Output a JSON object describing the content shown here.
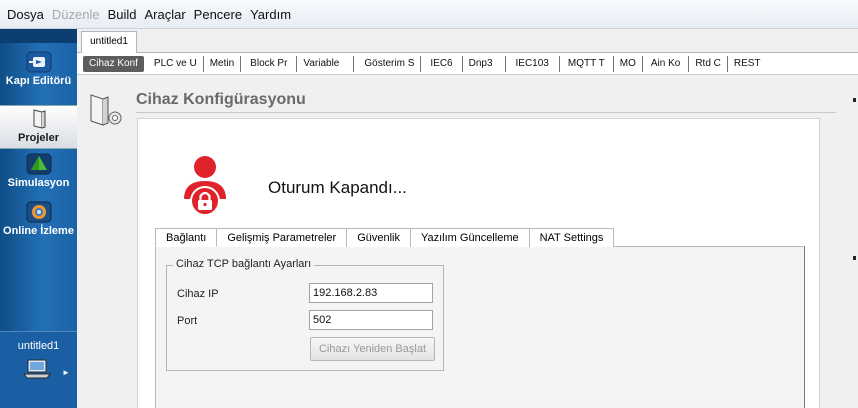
{
  "menu": [
    "Dosya",
    "Düzenle",
    "Build",
    "Araçlar",
    "Pencere",
    "Yardım"
  ],
  "sidebar": {
    "items": [
      {
        "label": "Kapı Editörü",
        "icon": "gateway-editor-icon"
      },
      {
        "label": "Projeler",
        "icon": "projects-icon"
      },
      {
        "label": "Simulasyon",
        "icon": "simulation-icon"
      },
      {
        "label": "Online İzleme",
        "icon": "online-monitor-icon"
      }
    ],
    "project_name": "untitled1",
    "project_icon": "laptop-icon"
  },
  "document_tab": "untitled1",
  "config_tabs": [
    "Cihaz Konf",
    "PLC ve U",
    "Metin",
    "Block Pr",
    "Variable",
    "Gösterim S",
    "IEC6",
    "Dnp3",
    "IEC103",
    "MQTT T",
    "MO",
    "Ain Ko",
    "Rtd C",
    "REST"
  ],
  "page": {
    "title": "Cihaz Konfigürasyonu",
    "status_text": "Oturum Kapandı..."
  },
  "inner_tabs": [
    "Bağlantı",
    "Gelişmiş Parametreler",
    "Güvenlik",
    "Yazılım Güncelleme",
    "NAT Settings"
  ],
  "connection": {
    "group_title": "Cihaz TCP bağlantı Ayarları",
    "ip_label": "Cihaz IP",
    "ip_value": "192.168.2.83",
    "port_label": "Port",
    "port_value": "502",
    "restart_button": "Cihazı Yeniden Başlat"
  },
  "colors": {
    "sidebar": "#2370b7",
    "active_config_tab": "#5d5d5d",
    "user_icon": "#e0232b",
    "title_text": "#6a6a6a"
  }
}
